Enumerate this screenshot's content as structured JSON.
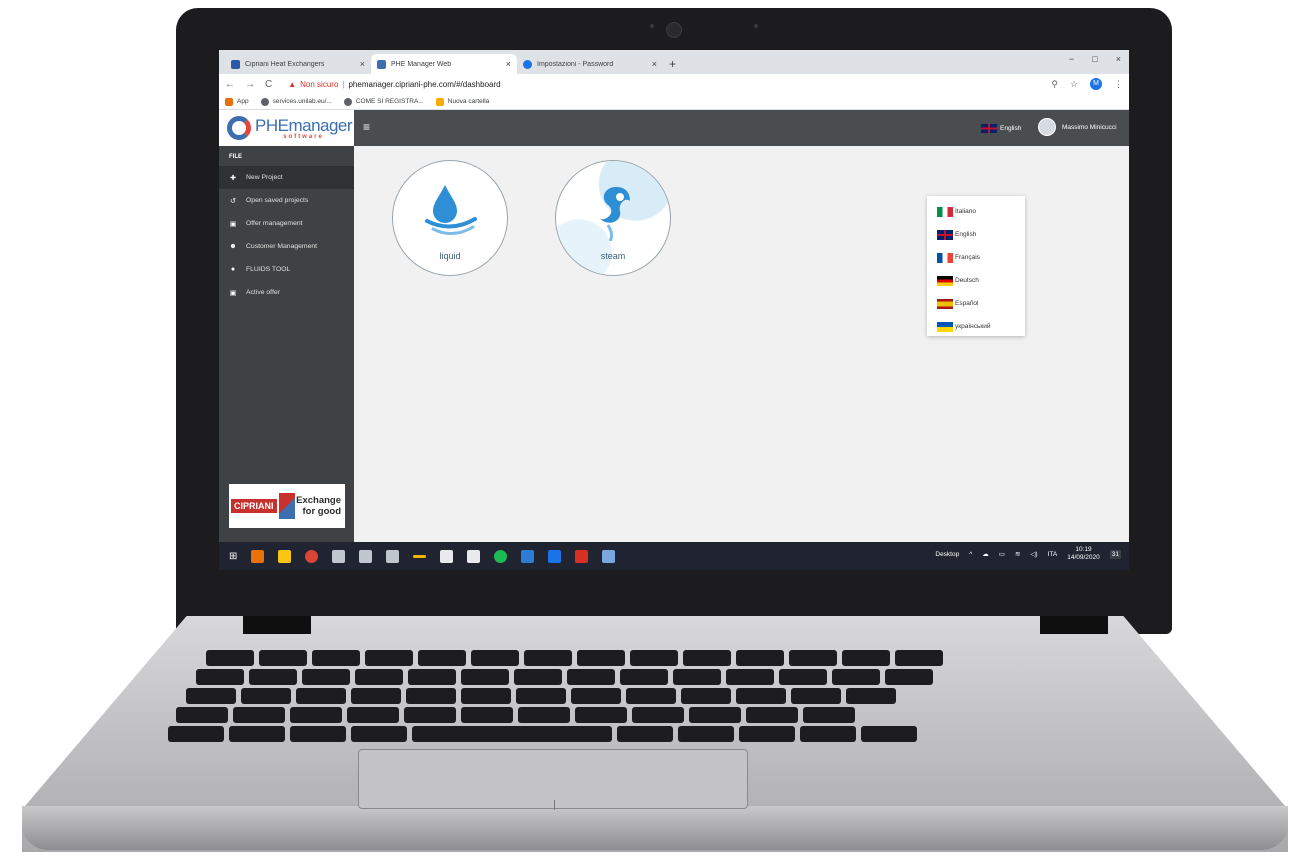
{
  "browser": {
    "tabs": [
      {
        "title": "Cipriani Heat Exchangers",
        "favicon_color": "#2d5aa6"
      },
      {
        "title": "PHE Manager Web",
        "favicon_color": "#3d6fb0"
      },
      {
        "title": "Impostazioni - Password",
        "favicon_color": "#1a73e8"
      }
    ],
    "new_tab": "+",
    "close": "×",
    "window_controls": {
      "minimize": "−",
      "maximize": "□",
      "close": "×"
    },
    "security_label": "Non sicuro",
    "url": "phemanager.cipriani-phe.com/#/dashboard",
    "profile_initial": "M",
    "bookmarks": [
      "App",
      "services.unilab.eu/...",
      "COME SI REGISTRA...",
      "Nuova cartella"
    ]
  },
  "app": {
    "logo": {
      "main": "PHEmanager",
      "sub": "software"
    },
    "section_header": "FILE",
    "menu": [
      {
        "label": "New Project",
        "icon": "plus-circle-icon",
        "glyph": "✚"
      },
      {
        "label": "Open saved projects",
        "icon": "history-icon",
        "glyph": "↺"
      },
      {
        "label": "Offer management",
        "icon": "card-icon",
        "glyph": "▣"
      },
      {
        "label": "Customer Management",
        "icon": "users-icon",
        "glyph": "☻"
      },
      {
        "label": "FLUIDS TOOL",
        "icon": "drop-icon",
        "glyph": "●"
      },
      {
        "label": "Active offer",
        "icon": "card-icon",
        "glyph": "▣"
      }
    ],
    "brand": {
      "name": "CIPRIANI",
      "tagline_1": "Exchange",
      "tagline_2": "for good"
    },
    "header": {
      "menu_glyph": "≡",
      "language": "English",
      "user": "Massimo Minicucci"
    },
    "fluids": [
      {
        "label": "liquid"
      },
      {
        "label": "steam"
      }
    ],
    "languages": [
      "Italiano",
      "English",
      "Français",
      "Deutsch",
      "Español",
      "український"
    ]
  },
  "taskbar": {
    "desktop_label": "Desktop",
    "lang": "ITA",
    "time": "10:19",
    "date": "14/09/2020",
    "notif": "31"
  },
  "colors": {
    "sidebar": "#3f4244",
    "topbar": "#4a4d50",
    "brand_blue": "#3d6fb0",
    "brand_red": "#e2473a",
    "fluid_blue": "#2f8fd6"
  }
}
